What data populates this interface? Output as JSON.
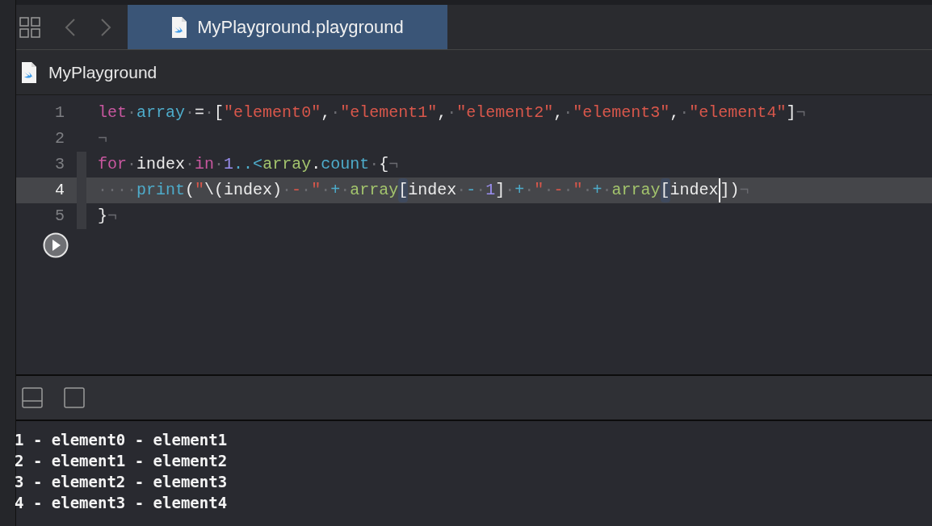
{
  "tab_bar": {
    "tabs": [
      {
        "label": "MyPlayground.playground",
        "selected": true
      }
    ]
  },
  "breadcrumb": {
    "label": "MyPlayground"
  },
  "editor": {
    "lines": [
      {
        "number": "1",
        "selected": false,
        "changed": false,
        "tokens": [
          {
            "kind": "keyword",
            "text": "let"
          },
          {
            "kind": "invisible",
            "text": "·"
          },
          {
            "kind": "declaration",
            "text": "array"
          },
          {
            "kind": "invisible",
            "text": "·"
          },
          {
            "kind": "plain",
            "text": "="
          },
          {
            "kind": "invisible",
            "text": "·"
          },
          {
            "kind": "plain",
            "text": "["
          },
          {
            "kind": "string",
            "text": "\"element0\""
          },
          {
            "kind": "plain",
            "text": ","
          },
          {
            "kind": "invisible",
            "text": "·"
          },
          {
            "kind": "string",
            "text": "\"element1\""
          },
          {
            "kind": "plain",
            "text": ","
          },
          {
            "kind": "invisible",
            "text": "·"
          },
          {
            "kind": "string",
            "text": "\"element2\""
          },
          {
            "kind": "plain",
            "text": ","
          },
          {
            "kind": "invisible",
            "text": "·"
          },
          {
            "kind": "string",
            "text": "\"element3\""
          },
          {
            "kind": "plain",
            "text": ","
          },
          {
            "kind": "invisible",
            "text": "·"
          },
          {
            "kind": "string",
            "text": "\"element4\""
          },
          {
            "kind": "plain",
            "text": "]"
          },
          {
            "kind": "invisible",
            "text": "¬"
          }
        ]
      },
      {
        "number": "2",
        "selected": false,
        "changed": false,
        "tokens": [
          {
            "kind": "invisible",
            "text": "¬"
          }
        ]
      },
      {
        "number": "3",
        "selected": false,
        "changed": true,
        "tokens": [
          {
            "kind": "keyword",
            "text": "for"
          },
          {
            "kind": "invisible",
            "text": "·"
          },
          {
            "kind": "plain",
            "text": "index"
          },
          {
            "kind": "invisible",
            "text": "·"
          },
          {
            "kind": "keyword",
            "text": "in"
          },
          {
            "kind": "invisible",
            "text": "·"
          },
          {
            "kind": "number",
            "text": "1"
          },
          {
            "kind": "operator",
            "text": "..<"
          },
          {
            "kind": "identifier",
            "text": "array"
          },
          {
            "kind": "plain",
            "text": "."
          },
          {
            "kind": "declaration",
            "text": "count"
          },
          {
            "kind": "invisible",
            "text": "·"
          },
          {
            "kind": "plain",
            "text": "{"
          },
          {
            "kind": "invisible",
            "text": "¬"
          }
        ]
      },
      {
        "number": "4",
        "selected": true,
        "changed": true,
        "tokens": [
          {
            "kind": "invisible",
            "text": "····"
          },
          {
            "kind": "declaration",
            "text": "print"
          },
          {
            "kind": "plain",
            "text": "("
          },
          {
            "kind": "string",
            "text": "\""
          },
          {
            "kind": "plain",
            "text": "\\(index)"
          },
          {
            "kind": "invisible",
            "text": "·"
          },
          {
            "kind": "string",
            "text": "-"
          },
          {
            "kind": "invisible",
            "text": "·"
          },
          {
            "kind": "string",
            "text": "\""
          },
          {
            "kind": "invisible",
            "text": "·"
          },
          {
            "kind": "operator",
            "text": "+"
          },
          {
            "kind": "invisible",
            "text": "·"
          },
          {
            "kind": "identifier",
            "text": "array"
          },
          {
            "kind": "bracket",
            "text": "["
          },
          {
            "kind": "plain",
            "text": "index"
          },
          {
            "kind": "invisible",
            "text": "·"
          },
          {
            "kind": "operator",
            "text": "-"
          },
          {
            "kind": "invisible",
            "text": "·"
          },
          {
            "kind": "number",
            "text": "1"
          },
          {
            "kind": "plain",
            "text": "]"
          },
          {
            "kind": "invisible",
            "text": "·"
          },
          {
            "kind": "operator",
            "text": "+"
          },
          {
            "kind": "invisible",
            "text": "·"
          },
          {
            "kind": "string",
            "text": "\""
          },
          {
            "kind": "invisible",
            "text": "·"
          },
          {
            "kind": "string",
            "text": "-"
          },
          {
            "kind": "invisible",
            "text": "·"
          },
          {
            "kind": "string",
            "text": "\""
          },
          {
            "kind": "invisible",
            "text": "·"
          },
          {
            "kind": "operator",
            "text": "+"
          },
          {
            "kind": "invisible",
            "text": "·"
          },
          {
            "kind": "identifier",
            "text": "array"
          },
          {
            "kind": "bracket",
            "text": "["
          },
          {
            "kind": "plain",
            "text": "index",
            "cursor": true
          },
          {
            "kind": "plain",
            "text": "])"
          },
          {
            "kind": "invisible",
            "text": "¬"
          }
        ]
      },
      {
        "number": "5",
        "selected": false,
        "changed": true,
        "tokens": [
          {
            "kind": "plain",
            "text": "}"
          },
          {
            "kind": "invisible",
            "text": "¬"
          }
        ]
      }
    ]
  },
  "console": {
    "lines": [
      "1 - element0 - element1",
      "2 - element1 - element2",
      "3 - element2 - element3",
      "4 - element3 - element4"
    ]
  }
}
